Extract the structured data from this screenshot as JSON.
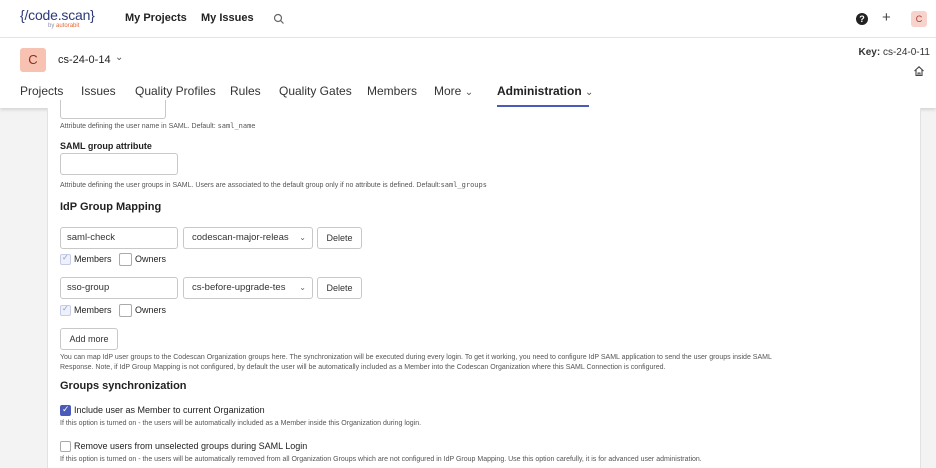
{
  "topbar": {
    "logo_main": "{/code.scan}",
    "logo_sub_prefix": "by ",
    "logo_sub_brand": "autorabit",
    "my_projects": "My Projects",
    "my_issues": "My Issues",
    "user_initial": "C",
    "plus": "+",
    "help": "?"
  },
  "project": {
    "avatar": "C",
    "name": "cs-24-0-14",
    "key_label": "Key:",
    "key_value": "cs-24-0-11",
    "tabs": [
      "Projects",
      "Issues",
      "Quality Profiles",
      "Rules",
      "Quality Gates",
      "Members",
      "More",
      "Administration"
    ]
  },
  "form": {
    "username_help": "Attribute defining the user name in SAML. Default: ",
    "username_default": "saml_name",
    "group_attr_label": "SAML group attribute",
    "group_attr_value": "",
    "group_attr_help": "Attribute defining the user groups in SAML. Users are associated to the default group only if no attribute is defined. Default:",
    "group_attr_default": "saml_groups",
    "idp_heading": "IdP Group Mapping",
    "mappings": [
      {
        "idp_group": "saml-check",
        "org_group": "codescan-major-releas",
        "delete": "Delete",
        "members": "Members",
        "owners": "Owners"
      },
      {
        "idp_group": "sso-group",
        "org_group": "cs-before-upgrade-tes",
        "delete": "Delete",
        "members": "Members",
        "owners": "Owners"
      }
    ],
    "add_more": "Add more",
    "mapping_help_1": "You can map IdP user groups to the Codescan Organization groups here. The synchronization will be executed during every login. To get it working, you need to configure IdP SAML application to send the user groups inside SAML",
    "mapping_help_2": "Response. Note, if IdP Group Mapping is not configured, by default the user will be automatically included as a Member into the Codescan Organization where this SAML Connection is configured.",
    "sync_heading": "Groups synchronization",
    "include_label": "Include user as Member to current Organization",
    "include_help": "If this option is turned on - the users will be automatically included as a Member inside this Organization during login.",
    "remove_label": "Remove users from unselected groups during SAML Login",
    "remove_help": "If this option is turned on - the users will be automatically removed from all Organization Groups which are not configured in IdP Group Mapping. Use this option carefully, it is for advanced user administration."
  }
}
